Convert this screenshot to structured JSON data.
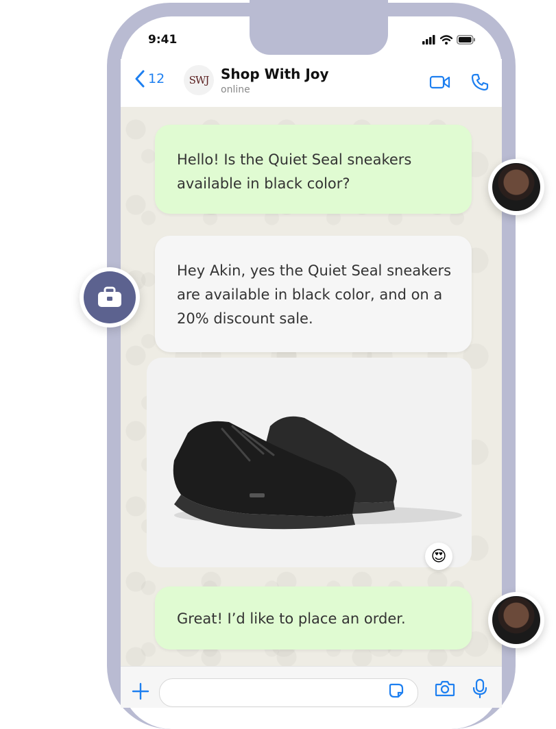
{
  "status_bar": {
    "time": "9:41"
  },
  "header": {
    "back_count": "12",
    "logo_text": "SWJ",
    "title": "Shop With Joy",
    "subtitle": "online"
  },
  "messages": [
    {
      "direction": "out",
      "text": "Hello! Is the Quiet Seal sneakers available in black color?"
    },
    {
      "direction": "in",
      "text": "Hey Akin, yes the Quiet Seal sneakers are available in black color, and on a 20% discount sale."
    },
    {
      "direction": "in",
      "type": "image",
      "image": "black-sneakers",
      "reaction": "😍"
    },
    {
      "direction": "out",
      "text": "Great! I’d like to place an order."
    }
  ],
  "input": {
    "placeholder": ""
  },
  "colors": {
    "phone_frame": "#b9bbd2",
    "accent": "#1d7ff0",
    "outgoing_bubble": "#e0fbd2",
    "incoming_bubble": "#f6f6f6",
    "business_avatar": "#5c628f"
  },
  "icons": [
    "chevron-left-icon",
    "video-call-icon",
    "phone-call-icon",
    "plus-icon",
    "sticker-icon",
    "camera-icon",
    "microphone-icon",
    "briefcase-icon",
    "signal-icon",
    "wifi-icon",
    "battery-icon"
  ]
}
